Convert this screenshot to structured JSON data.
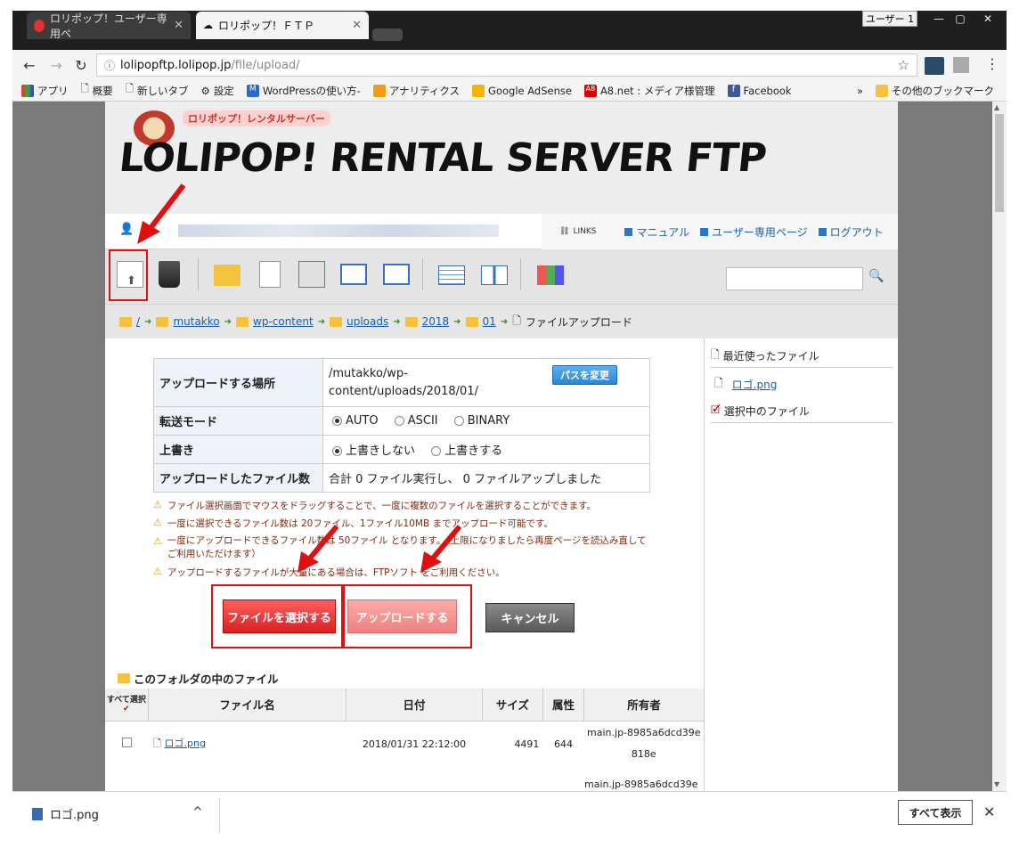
{
  "browser": {
    "tabs": [
      {
        "label": "ロリポップ！ユーザー専用ペ",
        "active": false
      },
      {
        "label": "ロリポップ！ＦＴＰ",
        "active": true
      }
    ],
    "user_badge": "ユーザー 1",
    "url_host": "lolipopftp.lolipop.jp",
    "url_path": "/file/upload/",
    "bookmarks": [
      "アプリ",
      "概要",
      "新しいタブ",
      "設定",
      "WordPressの使い方-",
      "アナリティクス",
      "Google AdSense",
      "A8.net : メディア様管理",
      "Facebook"
    ],
    "bookmarks_overflow": "»",
    "other_bookmarks": "その他のブックマーク"
  },
  "header": {
    "logo_text": "LOLIPOP! RENTAL SERVER FTP",
    "logo_sub": "ロリポップ！レンタルサーバー",
    "links_label": "LINKS",
    "links": [
      "マニュアル",
      "ユーザー専用ページ",
      "ログアウト"
    ]
  },
  "breadcrumb": {
    "root": "/",
    "items": [
      "mutakko",
      "wp-content",
      "uploads",
      "2018",
      "01"
    ],
    "current": "ファイルアップロード"
  },
  "sidebar": {
    "recent_title": "最近使ったファイル",
    "recent_file": "ロゴ.png",
    "selected_title": "選択中のファイル"
  },
  "form": {
    "location_label": "アップロードする場所",
    "location_value": "/mutakko/wp-content/uploads/2018/01/",
    "change_path": "パスを変更",
    "mode_label": "転送モード",
    "mode_options": [
      "AUTO",
      "ASCII",
      "BINARY"
    ],
    "overwrite_label": "上書き",
    "overwrite_options": [
      "上書きしない",
      "上書きする"
    ],
    "count_label": "アップロードしたファイル数",
    "count_value": "合計 0 ファイル実行し、 0 ファイルアップしました"
  },
  "notes": [
    "ファイル選択画面でマウスをドラッグすることで、一度に複数のファイルを選択することができます。",
    "一度に選択できるファイル数は 20ファイル、1ファイル10MB までアップロード可能です。",
    "一度にアップロードできるファイル数は 50ファイル となります。（上限になりましたら再度ページを読込み直してご利用いただけます）",
    "アップロードするファイルが大量にある場合は、FTPソフト をご利用ください。"
  ],
  "buttons": {
    "select": "ファイルを選択する",
    "upload": "アップロードする",
    "cancel": "キャンセル"
  },
  "files": {
    "heading": "このフォルダの中のファイル",
    "select_all": "すべて選択",
    "columns": [
      "ファイル名",
      "日付",
      "サイズ",
      "属性",
      "所有者"
    ],
    "rows": [
      {
        "name": "ロゴ.png",
        "date": "2018/01/31 22:12:00",
        "size": "4491",
        "attr": "644",
        "owner": "main.jp-8985a6dcd39e818e"
      }
    ],
    "partial_owner": "main.jp-8985a6dcd39e"
  },
  "download": {
    "file": "ロゴ.png",
    "show_all": "すべて表示"
  }
}
